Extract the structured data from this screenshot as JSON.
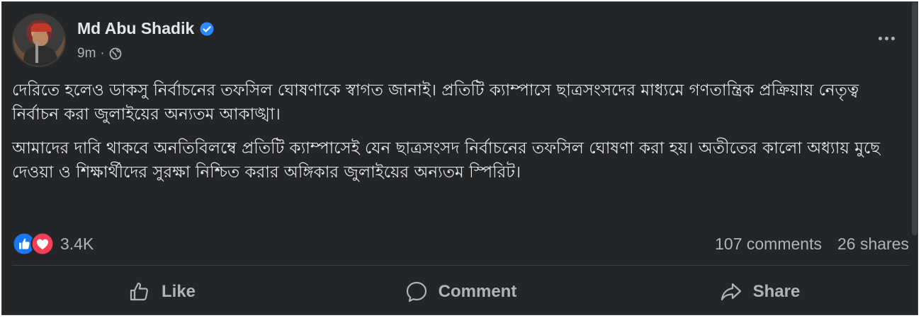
{
  "post": {
    "author": "Md Abu Shadik",
    "time": "9m",
    "separator": "·",
    "paragraphs": [
      "দেরিতে হলেও ডাকসু নির্বাচনের তফসিল ঘোষণাকে স্বাগত জানাই। প্রতিটি ক্যাম্পাসে ছাত্রসংসদের মাধ্যমে গণতান্ত্রিক প্রক্রিয়ায় নেতৃত্ব নির্বাচন করা জুলাইয়ের অন্যতম আকাঙ্খা।",
      "আমাদের দাবি থাকবে অনতিবিলম্বে প্রতিটি ক্যাম্পাসেই যেন ছাত্রসংসদ নির্বাচনের তফসিল ঘোষণা করা হয়। অতীতের কালো অধ্যায় মুছে দেওয়া ও শিক্ষার্থীদের সুরক্ষা নিশ্চিত করার অঙ্গিকার জুলাইয়ের অন্যতম স্পিরিট।"
    ]
  },
  "stats": {
    "reactions_count": "3.4K",
    "comments": "107 comments",
    "shares": "26 shares"
  },
  "actions": {
    "like": "Like",
    "comment": "Comment",
    "share": "Share"
  },
  "icons": {
    "verified": "verified-badge-icon",
    "audience": "globe-icon",
    "more": "more-options-icon",
    "reaction_like": "like-reaction-icon",
    "reaction_love": "love-reaction-icon",
    "like": "thumbs-up-icon",
    "comment": "speech-bubble-icon",
    "share": "share-arrow-icon"
  },
  "colors": {
    "background": "#242526",
    "text_primary": "#e4e6eb",
    "text_secondary": "#b0b3b8",
    "verified_blue": "#2d88ff",
    "like_blue": "#1877f2",
    "love_red": "#f33e58"
  }
}
